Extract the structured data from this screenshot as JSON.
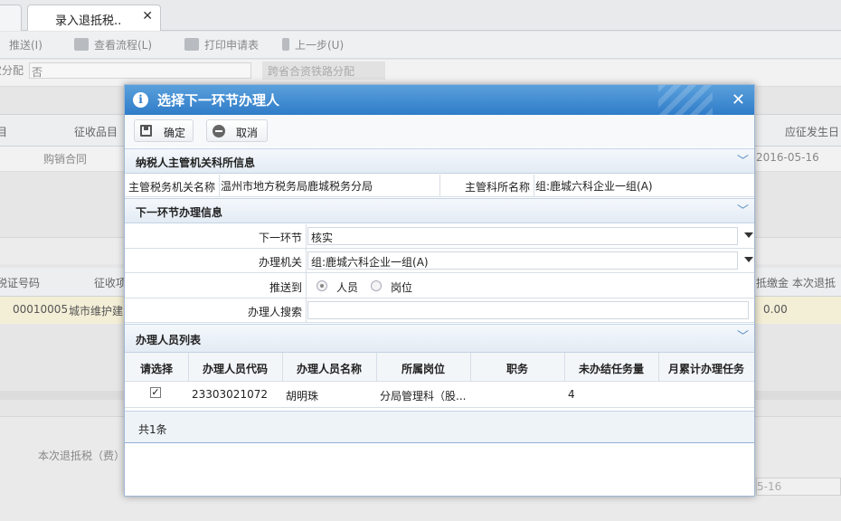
{
  "app": {
    "tabs": [
      {
        "label": ""
      },
      {
        "label": "录入退抵税.."
      }
    ],
    "tab_close": "✕",
    "toolbar": {
      "push": "推送(I)",
      "view_flow": "查看流程(L)",
      "print": "打印申请表",
      "prev_step": "上一步(U)"
    },
    "field_label": "农分配",
    "field_value": "否",
    "railway_btn": "跨省合资铁路分配",
    "grid1": {
      "headers": [
        "目",
        "征收品目",
        "应征发生日"
      ],
      "row": [
        "购销合同",
        "2016-05-16"
      ]
    },
    "grid2": {
      "headers": [
        "税证号码",
        "征收项",
        "抵缴金",
        "本次退抵"
      ],
      "row": [
        "00010005",
        "城市维护建",
        "0.00"
      ]
    },
    "bottom_label": "本次退抵税（费）",
    "bottom_date": "5-16"
  },
  "dialog": {
    "title": "选择下一环节办理人",
    "close": "✕",
    "buttons": {
      "confirm": "确定",
      "cancel": "取消"
    },
    "section_taxpayer": {
      "title": "纳税人主管机关科所信息",
      "authority_label": "主管税务机关名称",
      "authority_value": "温州市地方税务局鹿城税务分局",
      "section_label": "主管科所名称",
      "section_value": "组:鹿城六科企业一组(A)"
    },
    "section_next": {
      "title": "下一环节办理信息",
      "next_step_label": "下一环节",
      "next_step_value": "核实",
      "agency_label": "办理机关",
      "agency_value": "组:鹿城六科企业一组(A)",
      "push_to_label": "推送到",
      "radio_person": "人员",
      "radio_post": "岗位",
      "search_label": "办理人搜索",
      "search_value": ""
    },
    "section_list": {
      "title": "办理人员列表",
      "columns": [
        "请选择",
        "办理人员代码",
        "办理人员名称",
        "所属岗位",
        "职务",
        "未办结任务量",
        "月累计办理任务"
      ],
      "rows": [
        {
          "checked": true,
          "code": "23303021072",
          "name": "胡明珠",
          "post": "分局管理科（股...",
          "duty": "",
          "pending": "4",
          "monthly": ""
        }
      ],
      "footer": "共1条"
    }
  },
  "colors": {
    "dialog_header": "#2f7cc8",
    "section_bg": "#e3ebf4",
    "highlight_row": "#f3eed6"
  }
}
